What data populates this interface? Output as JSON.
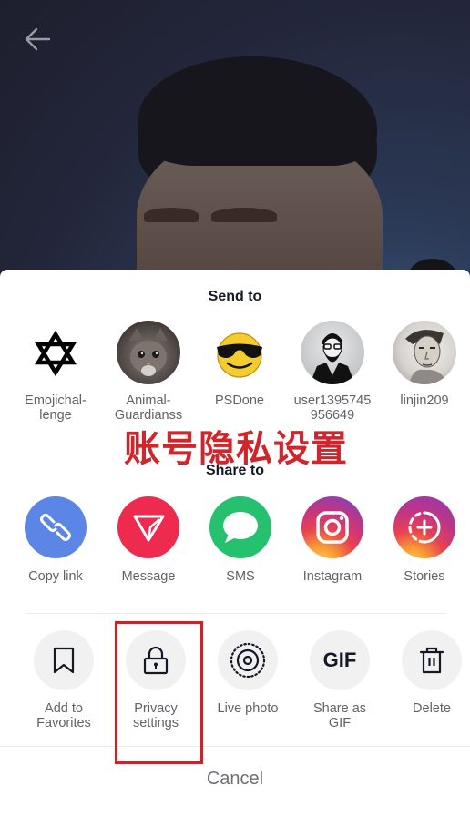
{
  "nav": {
    "back_icon": "arrow-left-icon"
  },
  "sheet": {
    "send_title": "Send to",
    "send_to": [
      {
        "name": "Emojichal-\nlenge",
        "line1": "Emojichal-",
        "line2": "lenge",
        "avatar": "star-of-david-icon"
      },
      {
        "line1": "Animal-",
        "line2": "Guardianss",
        "avatar": "kitten-photo"
      },
      {
        "line1": "PSDone",
        "line2": "",
        "avatar": "sunglasses-emoji"
      },
      {
        "line1": "user1395745",
        "line2": "956649",
        "avatar": "bearded-man-illustration"
      },
      {
        "line1": "linjin209",
        "line2": "",
        "avatar": "man-portrait-sketch"
      }
    ],
    "share_title": "Share to",
    "share_to": [
      {
        "label": "Copy link",
        "icon": "link-icon",
        "color": "#5b86e5"
      },
      {
        "label": "Message",
        "icon": "send-icon",
        "color": "#ee2a4f"
      },
      {
        "label": "SMS",
        "icon": "chat-bubble-icon",
        "color": "#25c16f"
      },
      {
        "label": "Instagram",
        "icon": "instagram-icon",
        "color": "#c13584"
      },
      {
        "label": "Stories",
        "icon": "stories-plus-icon",
        "color": "#b33ab4"
      }
    ],
    "actions": [
      {
        "line1": "Add to",
        "line2": "Favorites",
        "icon": "bookmark-icon"
      },
      {
        "line1": "Privacy",
        "line2": "settings",
        "icon": "lock-icon"
      },
      {
        "line1": "Live photo",
        "line2": "",
        "icon": "live-photo-icon"
      },
      {
        "line1": "Share as",
        "line2": "GIF",
        "icon": "gif-icon",
        "glyph": "GIF"
      },
      {
        "line1": "Delete",
        "line2": "",
        "icon": "trash-icon"
      }
    ],
    "cancel_label": "Cancel"
  },
  "annotation": {
    "caption": "账号隐私设置",
    "highlight_target": "Privacy settings",
    "color": "#c1272d"
  }
}
